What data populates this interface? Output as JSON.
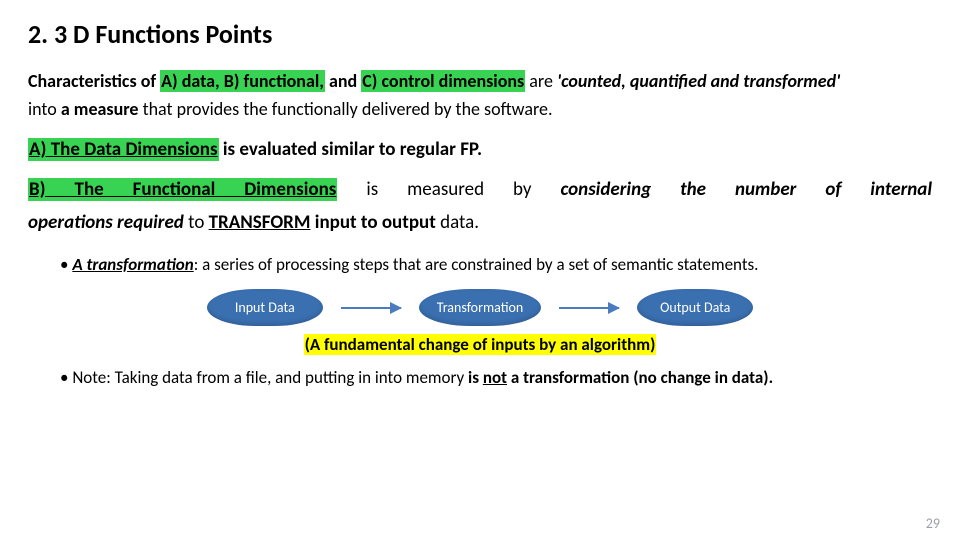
{
  "title": "2.  3 D Functions Points",
  "p1": {
    "lead": "Characteristics of ",
    "hl": "A) data, B) functional,",
    "mid": " and ",
    "hl2": "C) control dimensions",
    "tail1": " are ",
    "strong_tail": "'counted, quantified and transformed'",
    "line2_a": "into ",
    "line2_b": "a measure",
    "line2_c": " that provides the functionally delivered by the software."
  },
  "secA": {
    "label": "A) The Data Dimensions",
    "rest": " is evaluated similar to regular FP."
  },
  "secB": {
    "label": "B) The Functional Dimensions",
    "rest1": " is measured by ",
    "em": "considering the number of internal",
    "line2a": "operations required",
    "line2b": " to ",
    "line2c": "TRANSFORM",
    "line2d": " input to output",
    "line2e": " data."
  },
  "bullet1": {
    "lead": "A transformation",
    "rest": ": a series of processing steps that are constrained by a set of semantic statements."
  },
  "diagram": {
    "n1": "Input Data",
    "n2": "Transformation",
    "n3": "Output Data"
  },
  "caption": "(A fundamental change of inputs by an algorithm)",
  "bullet2": {
    "lead": "Note: Taking data from a file, and putting in into memory ",
    "strong1": "is ",
    "not": "not",
    "strong2": " a transformation (no change in data)."
  },
  "pagenum": "29"
}
